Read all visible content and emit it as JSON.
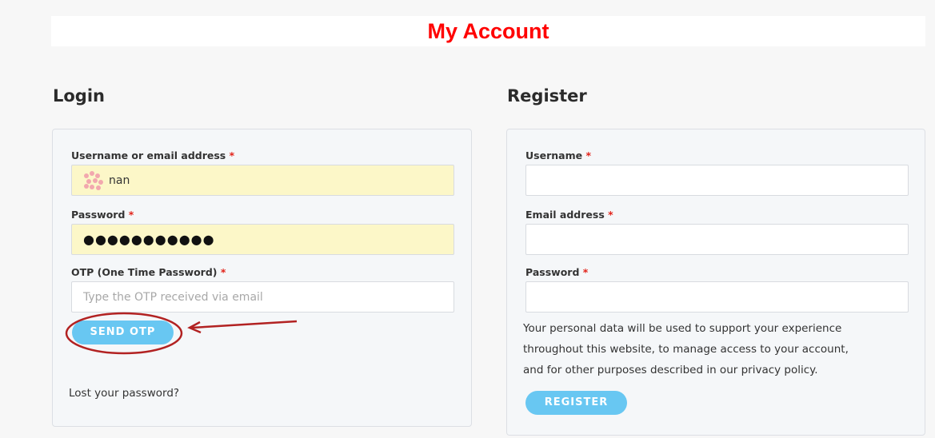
{
  "page_title": "My Account",
  "login": {
    "title": "Login",
    "username_label": "Username or email address",
    "username_value": "nan",
    "password_label": "Password",
    "password_value": "●●●●●●●●●●●",
    "otp_label": "OTP (One Time Password)",
    "otp_placeholder": "Type the OTP received via email",
    "send_otp_label": "SEND OTP",
    "lost_password_label": "Lost your password?"
  },
  "register": {
    "title": "Register",
    "username_label": "Username",
    "email_label": "Email address",
    "password_label": "Password",
    "privacy_text": [
      "Your personal data will be used to support your experience",
      "throughout this website, to manage access to your account,",
      "and for other purposes described in our privacy policy."
    ],
    "register_label": "REGISTER"
  },
  "required_mark": "*",
  "colors": {
    "title": "#ff0000",
    "button": "#68c7f2",
    "required": "#e2231a",
    "autofill": "#fcf7c8",
    "annotation": "#b22222"
  }
}
